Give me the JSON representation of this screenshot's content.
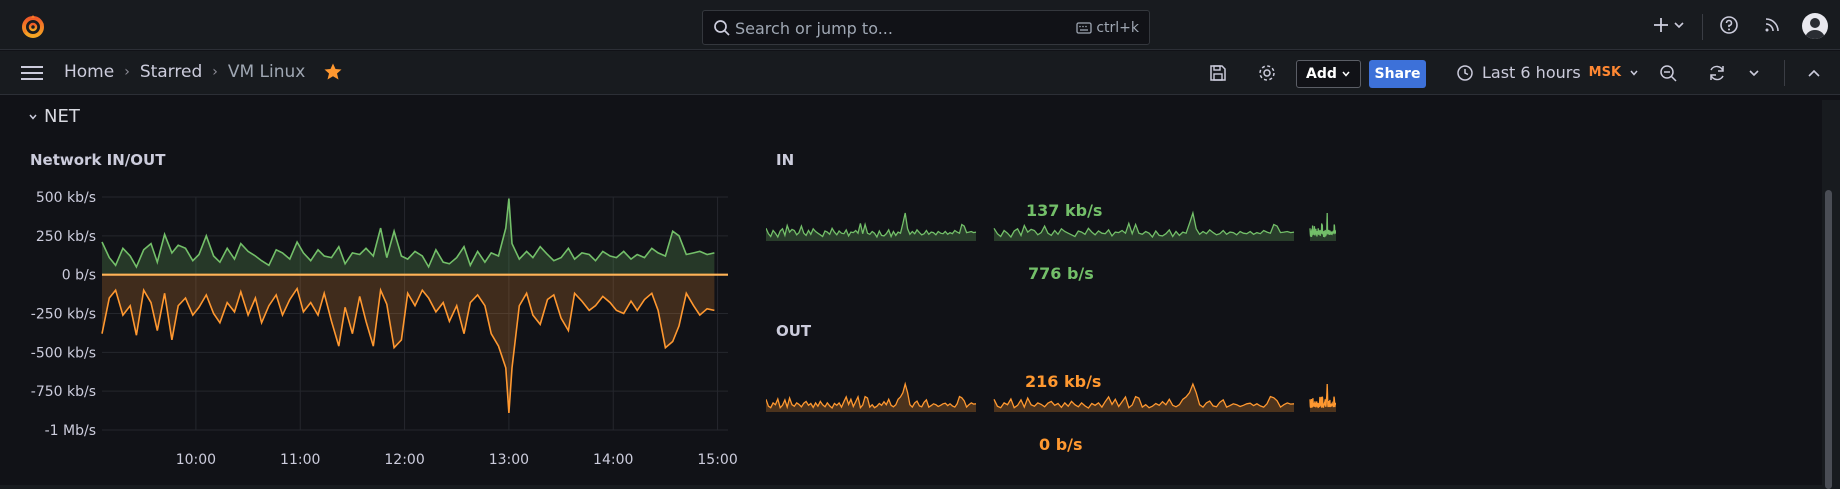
{
  "topbar": {
    "search_placeholder": "Search or jump to...",
    "search_shortcut": "ctrl+k",
    "icons": [
      "grafana-logo-icon",
      "search-icon",
      "keyboard-icon",
      "plus-icon",
      "chevron-down-icon",
      "help-icon",
      "rss-icon",
      "user-avatar-icon"
    ]
  },
  "breadcrumb": {
    "home": "Home",
    "starred": "Starred",
    "current": "VM Linux"
  },
  "toolbar": {
    "add_label": "Add",
    "share_label": "Share",
    "time_range": "Last 6 hours",
    "timezone": "MSK"
  },
  "row": {
    "title": "NET"
  },
  "panels": {
    "network": {
      "title": "Network IN/OUT"
    },
    "in": {
      "title": "IN",
      "value_top": "137 kb/s",
      "value_bottom": "776 b/s",
      "color": "#73bf69"
    },
    "out": {
      "title": "OUT",
      "value_top": "216 kb/s",
      "value_bottom": "0 b/s",
      "color": "#ff9830"
    }
  },
  "chart_data": {
    "type": "area",
    "title": "Network IN/OUT",
    "y_ticks": [
      "500 kb/s",
      "250 kb/s",
      "0 b/s",
      "-250 kb/s",
      "-500 kb/s",
      "-750 kb/s",
      "-1 Mb/s"
    ],
    "y_tick_values": [
      500,
      250,
      0,
      -250,
      -500,
      -750,
      -1000
    ],
    "ylim": [
      -1000,
      500
    ],
    "x_ticks": [
      "10:00",
      "11:00",
      "12:00",
      "13:00",
      "14:00",
      "15:00"
    ],
    "x_tick_hours": [
      10,
      11,
      12,
      13,
      14,
      15
    ],
    "xlim": [
      9.1,
      15.1
    ],
    "series": [
      {
        "color": "#73bf69",
        "x": [
          9.1,
          9.17,
          9.23,
          9.3,
          9.37,
          9.43,
          9.5,
          9.57,
          9.63,
          9.7,
          9.77,
          9.83,
          9.9,
          9.97,
          10.03,
          10.1,
          10.17,
          10.23,
          10.3,
          10.37,
          10.43,
          10.5,
          10.57,
          10.63,
          10.7,
          10.77,
          10.83,
          10.9,
          10.97,
          11.03,
          11.1,
          11.17,
          11.23,
          11.3,
          11.37,
          11.43,
          11.5,
          11.57,
          11.63,
          11.7,
          11.77,
          11.83,
          11.9,
          11.97,
          12.03,
          12.1,
          12.17,
          12.23,
          12.3,
          12.37,
          12.43,
          12.5,
          12.57,
          12.63,
          12.7,
          12.77,
          12.83,
          12.9,
          12.97,
          13.0,
          13.03,
          13.1,
          13.17,
          13.23,
          13.3,
          13.37,
          13.43,
          13.5,
          13.57,
          13.63,
          13.7,
          13.77,
          13.83,
          13.9,
          13.97,
          14.03,
          14.1,
          14.17,
          14.23,
          14.3,
          14.37,
          14.43,
          14.5,
          14.57,
          14.63,
          14.7,
          14.77,
          14.83,
          14.9,
          14.97
        ],
        "y": [
          210,
          110,
          60,
          170,
          120,
          50,
          160,
          200,
          80,
          260,
          140,
          190,
          170,
          90,
          130,
          250,
          120,
          80,
          170,
          100,
          200,
          150,
          120,
          90,
          60,
          160,
          140,
          100,
          210,
          140,
          90,
          160,
          120,
          110,
          180,
          70,
          140,
          130,
          170,
          120,
          300,
          110,
          280,
          120,
          100,
          150,
          120,
          50,
          160,
          80,
          70,
          110,
          180,
          60,
          150,
          80,
          140,
          120,
          300,
          490,
          200,
          100,
          150,
          110,
          180,
          130,
          90,
          110,
          170,
          100,
          140,
          130,
          90,
          150,
          120,
          110,
          150,
          100,
          130,
          110,
          170,
          140,
          120,
          280,
          250,
          130,
          140,
          150,
          130,
          140
        ]
      },
      {
        "color": "#ff9830",
        "x": [
          9.1,
          9.17,
          9.23,
          9.3,
          9.37,
          9.43,
          9.5,
          9.57,
          9.63,
          9.7,
          9.77,
          9.83,
          9.9,
          9.97,
          10.03,
          10.1,
          10.17,
          10.23,
          10.3,
          10.37,
          10.43,
          10.5,
          10.57,
          10.63,
          10.7,
          10.77,
          10.83,
          10.9,
          10.97,
          11.03,
          11.1,
          11.17,
          11.23,
          11.3,
          11.37,
          11.43,
          11.5,
          11.57,
          11.63,
          11.7,
          11.77,
          11.83,
          11.9,
          11.97,
          12.03,
          12.1,
          12.17,
          12.23,
          12.3,
          12.37,
          12.43,
          12.5,
          12.57,
          12.63,
          12.7,
          12.77,
          12.83,
          12.9,
          12.97,
          13.0,
          13.03,
          13.1,
          13.17,
          13.23,
          13.3,
          13.37,
          13.43,
          13.5,
          13.57,
          13.63,
          13.7,
          13.77,
          13.83,
          13.9,
          13.97,
          14.03,
          14.1,
          14.17,
          14.23,
          14.3,
          14.37,
          14.43,
          14.5,
          14.57,
          14.63,
          14.7,
          14.77,
          14.83,
          14.9,
          14.97
        ],
        "y": [
          -380,
          -150,
          -100,
          -260,
          -200,
          -390,
          -100,
          -180,
          -360,
          -120,
          -420,
          -200,
          -150,
          -260,
          -210,
          -130,
          -250,
          -310,
          -180,
          -240,
          -110,
          -260,
          -150,
          -310,
          -200,
          -130,
          -260,
          -160,
          -90,
          -240,
          -180,
          -260,
          -120,
          -300,
          -460,
          -210,
          -380,
          -140,
          -300,
          -460,
          -100,
          -190,
          -470,
          -420,
          -120,
          -200,
          -100,
          -150,
          -240,
          -180,
          -300,
          -200,
          -380,
          -180,
          -130,
          -200,
          -380,
          -460,
          -600,
          -890,
          -600,
          -200,
          -120,
          -260,
          -320,
          -160,
          -130,
          -280,
          -360,
          -120,
          -170,
          -230,
          -200,
          -140,
          -180,
          -230,
          -250,
          -170,
          -230,
          -160,
          -120,
          -230,
          -470,
          -430,
          -330,
          -120,
          -200,
          -260,
          -220,
          -230
        ]
      }
    ],
    "grid": true
  }
}
